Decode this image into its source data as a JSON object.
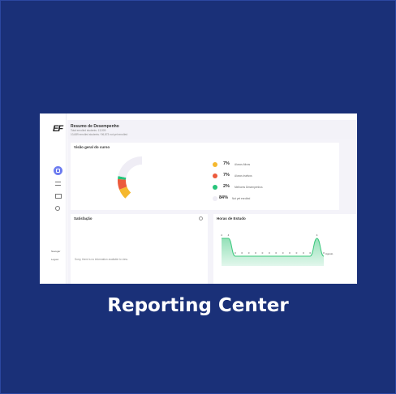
{
  "caption": "Reporting Center",
  "app": {
    "logo": "EF",
    "header": {
      "title": "Resumo de Desempenho",
      "subtitle1": "Total enrolled students: 13,909",
      "subtitle2": "10,689 enrolled students / 96,873 not yet enrolled"
    },
    "sidebar": {
      "icons": [
        "home-icon",
        "list-icon",
        "card-icon",
        "search-icon"
      ],
      "link_top": "Navegar",
      "link_bottom": "Logout"
    },
    "overview": {
      "title": "Visão geral do curso",
      "legend": [
        {
          "pct": "7%",
          "label": "Alunos Ativos",
          "color": "#f5b82e"
        },
        {
          "pct": "7%",
          "label": "Alunos Inativos",
          "color": "#ec5a3c"
        },
        {
          "pct": "2%",
          "label": "Melhores Desempenhos",
          "color": "#26c47a"
        },
        {
          "pct": "84%",
          "label": "Not yet enrolled",
          "color": "#efedf5"
        }
      ],
      "chart_data": {
        "type": "pie",
        "categories": [
          "Alunos Ativos",
          "Alunos Inativos",
          "Melhores Desempenhos",
          "Not yet enrolled"
        ],
        "values": [
          7,
          7,
          2,
          84
        ],
        "colors": [
          "#f5b82e",
          "#ec5a3c",
          "#26c47a",
          "#efedf5"
        ]
      }
    },
    "satisfaction": {
      "title": "Satisfação",
      "empty_message": "Sorry, there is no information available to view."
    },
    "hours": {
      "title": "Horas de Estudo",
      "chart_data": {
        "type": "area",
        "values": [
          4,
          4,
          0,
          0,
          0,
          0,
          0,
          0,
          0,
          0,
          0,
          0,
          0,
          0,
          4,
          0
        ],
        "labels": [
          "4",
          "4",
          "0",
          "0",
          "0",
          "0",
          "0",
          "0",
          "0",
          "0",
          "0",
          "0",
          "0",
          "0",
          "4",
          "0"
        ],
        "color": "#3cc87e",
        "last_label": "Agosto"
      }
    }
  }
}
